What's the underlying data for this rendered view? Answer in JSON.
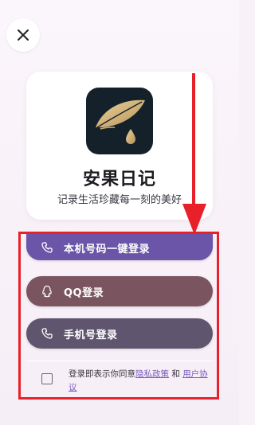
{
  "close_button": {
    "icon": "close-icon"
  },
  "app": {
    "name": "安果日记",
    "slogan": "记录生活珍藏每一刻的美好",
    "logo_icon": "feather-drop-logo"
  },
  "login_buttons": [
    {
      "label": "本机号码一键登录",
      "icon": "phone-icon",
      "color": "#6b55a8"
    },
    {
      "label": "QQ登录",
      "icon": "qq-icon",
      "color": "#7a5560"
    },
    {
      "label": "手机号登录",
      "icon": "phone-icon",
      "color": "#5f556e"
    }
  ],
  "agreement": {
    "prefix": "登录即表示你同意",
    "privacy_link": "隐私政策",
    "conjunction": " 和 ",
    "terms_link": "用户协议",
    "checked": false
  },
  "annotation": {
    "frame_color": "#e8202a",
    "arrow_color": "#e8202a"
  }
}
